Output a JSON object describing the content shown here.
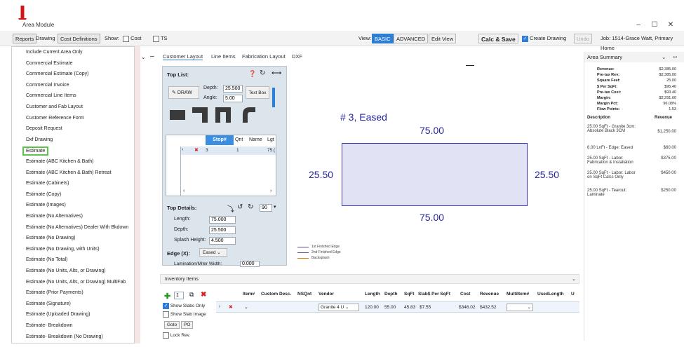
{
  "window": {
    "title": "Area Module",
    "minimize": "–",
    "maximize": "☐",
    "close": "✕"
  },
  "toolbar": {
    "reports": "Reports",
    "drawing": "Drawing",
    "cost_definitions": "Cost Definitions",
    "show_label": "Show:",
    "cost_label": "Cost",
    "ts_label": "TS",
    "view_label": "View:",
    "basic": "BASIC",
    "advanced": "ADVANCED",
    "edit_view": "Edit View",
    "calc_save": "Calc & Save",
    "create_drawing": "Create Drawing",
    "undo": "Undo",
    "job": "Job: 1514-Grace Watt, Primary Home"
  },
  "menu": {
    "items": [
      "Include Current Area Only",
      "Commercial Estimate",
      "Commercial Estimate (Copy)",
      "Commercial Invoice",
      "Commercial Line Items",
      "Customer and Fab Layout",
      "Customer Reference Form",
      "Deposit Request",
      "Dxf Drawing",
      "Estimate",
      "Estimate (ABC Kitchen & Bath)",
      "Estimate (ABC Kitchen & Bath) Retreat",
      "Estimate (Cabinets)",
      "Estimate (Copy)",
      "Estimate (Images)",
      "Estimate (No Alternatives)",
      "Estimate (No Alternatives) Dealer With Bkdown",
      "Estimate (No Drawing)",
      "Estimate (No Drawing, with Units)",
      "Estimate (No Total)",
      "Estimate (No Units, Alts, or Drawing)",
      "Estimate (No Units, Alts, or Drawing) MultiFab",
      "Estimate (Prior Payments)",
      "Estimate (Signature)",
      "Estimate (Uploaded Drawing)",
      "Estimate- Breakdown",
      "Estimate- Breakdown (No Drawing)"
    ],
    "highlighted": "Estimate"
  },
  "tabs": [
    "Customer Layout",
    "Line Items",
    "Fabrication Layout",
    "DXF"
  ],
  "toplist": {
    "title": "Top List:",
    "draw": "DRAW",
    "depth_label": "Depth:",
    "depth_value": "25.500",
    "angle_label": "Angle:",
    "angle_value": "5.00",
    "textbox": "Text Box",
    "grid_headers": [
      "Stop#",
      "Qnt",
      "Name",
      "Lgt"
    ],
    "grid_row": [
      "3",
      "1",
      "",
      "75.("
    ],
    "row_num": "1",
    "details_title": "Top Details:",
    "details_num": "90",
    "length_label": "Length:",
    "length_value": "75.000",
    "depth2_label": "Depth:",
    "depth2_value": "25.500",
    "splash_label": "Splash Height:",
    "splash_value": "4.500",
    "edge_label": "Edge (X):",
    "edge_value": "Eased",
    "lam_label": "Lamination/Miter Width:",
    "lam_value": "0.000"
  },
  "drawing": {
    "label": "# 3, Eased",
    "top": "75.00",
    "bottom": "75.00",
    "left": "25.50",
    "right": "25.50",
    "legend": [
      "1st Finished Edge",
      "2nd Finished Edge",
      "Backsplash"
    ]
  },
  "area_summary": {
    "title": "Area Summary",
    "summary": [
      {
        "label": "Revenue:",
        "value": "$2,385.00"
      },
      {
        "label": "Pre-tax Rev:",
        "value": "$2,385.00"
      },
      {
        "label": "Square Feet:",
        "value": "25.00"
      },
      {
        "label": "$ Per SqFt:",
        "value": "$95.40"
      },
      {
        "label": "Pre-tax Cost:",
        "value": "$93.40"
      },
      {
        "label": "Margin:",
        "value": "$2,291.60"
      },
      {
        "label": "Margin Pct:",
        "value": "96.08%"
      },
      {
        "label": "Flow Points:",
        "value": "1.53"
      }
    ],
    "desc_header": "Description",
    "rev_header": "Revenue",
    "lines": [
      {
        "desc": "25.00 SqFt - Granite 3cm: Absolute Black 3CM",
        "rev": "$1,250.00"
      },
      {
        "desc": "6.00 LnFt - Edge: Eased",
        "rev": "$60.00"
      },
      {
        "desc": "25.00 SqFt - Labor: Fabrication & Installation",
        "rev": "$375.00"
      },
      {
        "desc": "25.00 SqFt - Labor: Labor on SqFt Calcs Only",
        "rev": "$450.00"
      },
      {
        "desc": "25.00 SqFt - Tearout: Laminate",
        "rev": "$250.00"
      }
    ]
  },
  "inventory": {
    "title": "Inventory Items",
    "qty": "1",
    "show_slabs_only": "Show Slabs Only",
    "show_slab_image": "Show Slab Image",
    "goto": "Goto",
    "po": "PO",
    "lock_rev": "Lock Rev.",
    "headers": [
      "Item#",
      "Custom Desc.",
      "NSQnt",
      "Vendor",
      "Length",
      "Depth",
      "SqFt",
      "Slab$ Per SqFt",
      "Cost",
      "Revenue",
      "MultiItem#",
      "UsedLength",
      "U"
    ],
    "row": {
      "vendor": "Granite 4 U",
      "length": "120.00",
      "depth": "55.00",
      "sqft": "45.83",
      "slab": "$7.55",
      "cost": "$346.02",
      "revenue": "$432.52"
    }
  }
}
